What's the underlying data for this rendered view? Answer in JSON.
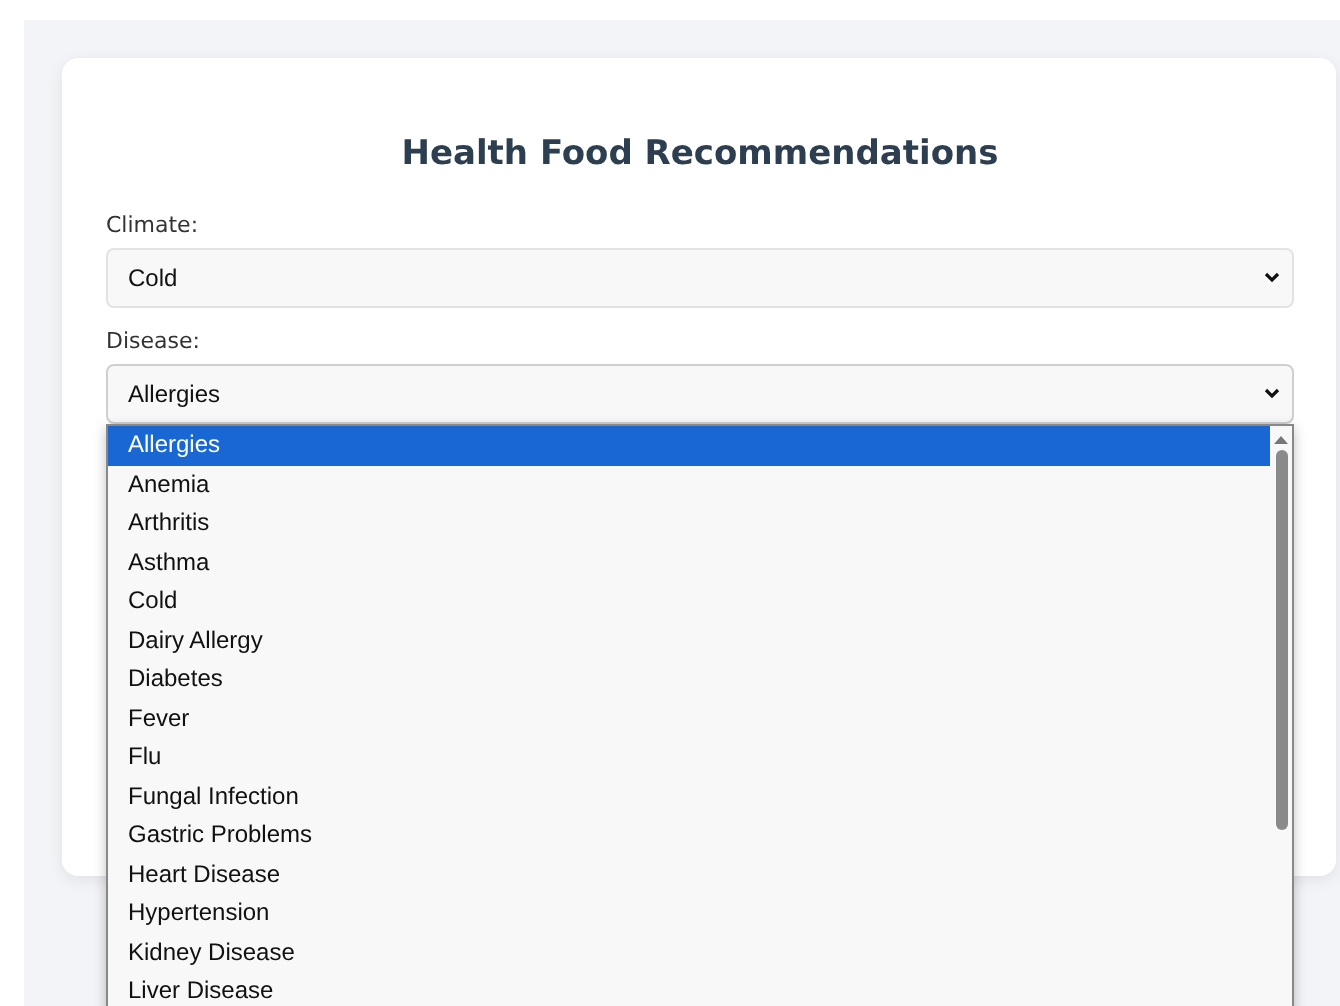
{
  "title": "Health Food Recommendations",
  "fields": [
    {
      "label": "Climate:",
      "value": "Cold",
      "expanded": false
    },
    {
      "label": "Disease:",
      "value": "Allergies",
      "expanded": true
    }
  ],
  "dropdown_options": [
    {
      "label": "Allergies",
      "selected": true
    },
    {
      "label": "Anemia",
      "selected": false
    },
    {
      "label": "Arthritis",
      "selected": false
    },
    {
      "label": "Asthma",
      "selected": false
    },
    {
      "label": "Cold",
      "selected": false
    },
    {
      "label": "Dairy Allergy",
      "selected": false
    },
    {
      "label": "Diabetes",
      "selected": false
    },
    {
      "label": "Fever",
      "selected": false
    },
    {
      "label": "Flu",
      "selected": false
    },
    {
      "label": "Fungal Infection",
      "selected": false
    },
    {
      "label": "Gastric Problems",
      "selected": false
    },
    {
      "label": "Heart Disease",
      "selected": false
    },
    {
      "label": "Hypertension",
      "selected": false
    },
    {
      "label": "Kidney Disease",
      "selected": false
    },
    {
      "label": "Liver Disease",
      "selected": false
    }
  ]
}
